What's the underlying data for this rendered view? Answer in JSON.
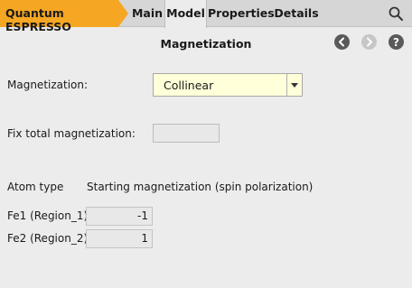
{
  "app": {
    "name": "Quantum ESPRESSO",
    "accent_color": "#f5a623"
  },
  "tabs": [
    {
      "label": "Main",
      "active": false
    },
    {
      "label": "Model",
      "active": true
    },
    {
      "label": "Properties",
      "active": false
    },
    {
      "label": "Details",
      "active": false
    }
  ],
  "page": {
    "title": "Magnetization"
  },
  "nav": {
    "back_icon": "chevron-left-circle-icon",
    "forward_icon": "chevron-right-circle-icon",
    "help_icon": "question-circle-icon",
    "search_icon": "magnifier-icon"
  },
  "form": {
    "magnetization_label": "Magnetization:",
    "magnetization_value": "Collinear",
    "fix_total_label": "Fix total magnetization:",
    "fix_total_value": ""
  },
  "atoms": {
    "header_type": "Atom type",
    "header_start": "Starting magnetization (spin polarization)",
    "rows": [
      {
        "label": "Fe1 (Region_1)",
        "value": "-1"
      },
      {
        "label": "Fe2 (Region_2)",
        "value": "1"
      }
    ]
  }
}
